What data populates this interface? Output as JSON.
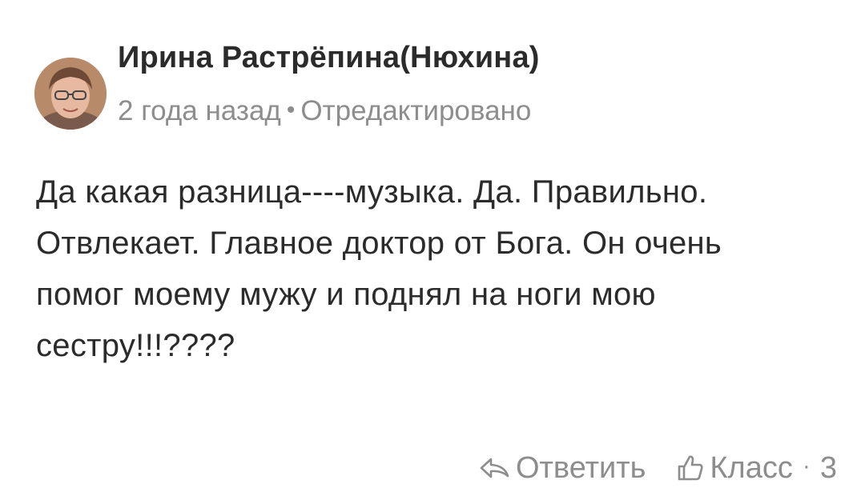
{
  "comment": {
    "author_name": "Ирина Растрёпина(Нюхина)",
    "timestamp": "2 года назад",
    "separator": "•",
    "edited_label": "Отредактировано",
    "text": "Да какая разница----музыка. Да. Правильно. Отвлекает. Главное доктор от Бога. Он очень помог моему мужу и поднял на ноги мою сестру!!!????",
    "actions": {
      "reply_label": "Ответить",
      "reply_icon": "reply-arrow-icon",
      "like_label": "Класс",
      "like_icon": "thumbs-up-icon",
      "count_separator": "·",
      "like_count": "3"
    }
  },
  "colors": {
    "text": "#2b2b2b",
    "muted": "#8d8d8d",
    "background": "#ffffff"
  }
}
